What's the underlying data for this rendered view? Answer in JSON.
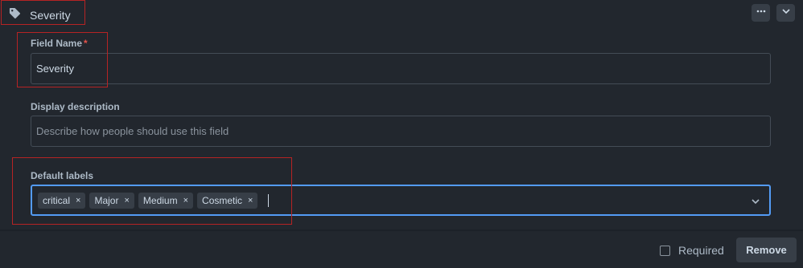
{
  "header": {
    "field_type_icon": "tag-icon",
    "field_type_label": "Severity",
    "more_icon": "kebab-horizontal-icon",
    "collapse_icon": "chevron-down-icon"
  },
  "form": {
    "field_name": {
      "label": "Field Name",
      "required_marker": "*",
      "value": "Severity"
    },
    "display_description": {
      "label": "Display description",
      "placeholder": "Describe how people should use this field"
    },
    "default_labels": {
      "label": "Default labels",
      "chips": [
        "critical",
        "Major",
        "Medium",
        "Cosmetic"
      ],
      "remove_glyph": "×",
      "dropdown_icon": "chevron-down-icon"
    }
  },
  "footer": {
    "required_label": "Required",
    "required_checked": false,
    "remove_label": "Remove"
  },
  "colors": {
    "background": "#22272e",
    "focus_border": "#539bf5",
    "highlight_box": "#b62324",
    "required_star": "#e5534b"
  }
}
